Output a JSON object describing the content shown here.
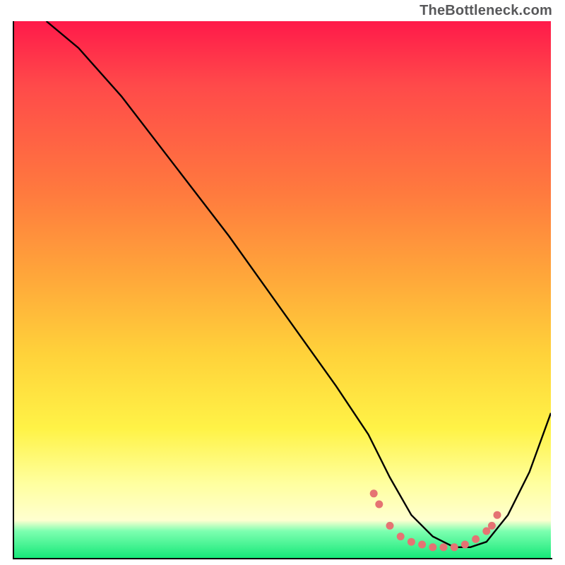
{
  "watermark": "TheBottleneck.com",
  "colors": {
    "gradient_top": "#ff1a4a",
    "gradient_mid1": "#ff7a3e",
    "gradient_mid2": "#ffd23a",
    "gradient_mid3": "#ffff9e",
    "gradient_bottom": "#16e879",
    "curve": "#000000",
    "marker": "#e57373",
    "axis": "#000000"
  },
  "chart_data": {
    "type": "line",
    "title": "",
    "xlabel": "",
    "ylabel": "",
    "xlim": [
      0,
      100
    ],
    "ylim": [
      0,
      100
    ],
    "grid": false,
    "series": [
      {
        "name": "curve",
        "x": [
          6,
          12,
          20,
          30,
          40,
          50,
          60,
          66,
          70,
          74,
          78,
          82,
          85,
          88,
          92,
          96,
          100
        ],
        "y": [
          100,
          95,
          86,
          73,
          60,
          46,
          32,
          23,
          15,
          8,
          4,
          2,
          2,
          3,
          8,
          16,
          27
        ]
      }
    ],
    "markers": [
      {
        "x": 67,
        "y": 12
      },
      {
        "x": 68,
        "y": 10
      },
      {
        "x": 70,
        "y": 6
      },
      {
        "x": 72,
        "y": 4
      },
      {
        "x": 74,
        "y": 3
      },
      {
        "x": 76,
        "y": 2.5
      },
      {
        "x": 78,
        "y": 2
      },
      {
        "x": 80,
        "y": 2
      },
      {
        "x": 82,
        "y": 2
      },
      {
        "x": 84,
        "y": 2.5
      },
      {
        "x": 86,
        "y": 3.5
      },
      {
        "x": 88,
        "y": 5
      },
      {
        "x": 89,
        "y": 6
      },
      {
        "x": 90,
        "y": 8
      }
    ],
    "annotations": []
  }
}
